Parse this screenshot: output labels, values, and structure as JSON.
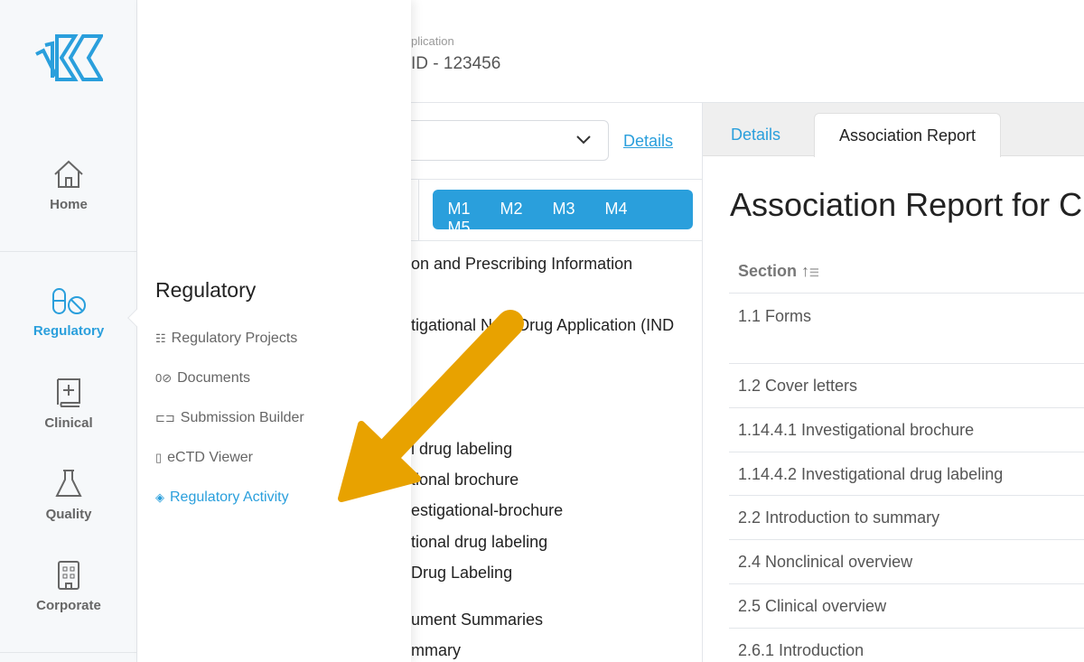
{
  "header": {
    "subtitle": "plication",
    "id": "ID - 123456"
  },
  "rail": {
    "items": [
      {
        "label": "Home",
        "icon": "home-icon"
      },
      {
        "label": "Regulatory",
        "icon": "pill-icon",
        "active": true
      },
      {
        "label": "Clinical",
        "icon": "medical-book-icon"
      },
      {
        "label": "Quality",
        "icon": "flask-icon"
      },
      {
        "label": "Corporate",
        "icon": "building-icon"
      }
    ]
  },
  "flyout": {
    "title": "Regulatory",
    "items": [
      {
        "label": "Regulatory Projects",
        "icon": "checklist-icon"
      },
      {
        "label": "Documents",
        "icon": "pill-icon"
      },
      {
        "label": "Submission Builder",
        "icon": "folder-tree-icon"
      },
      {
        "label": "eCTD Viewer",
        "icon": "clipboard-icon"
      },
      {
        "label": "Regulatory Activity",
        "icon": "clipboard-badge-icon",
        "active": true
      }
    ]
  },
  "middle": {
    "details_link": "Details",
    "modules": [
      "M1",
      "M2",
      "M3",
      "M4",
      "M5"
    ],
    "tree": [
      "on and Prescribing Information",
      "tigational New Drug Application (IND",
      "l drug labeling",
      "tional brochure",
      "estigational-brochure",
      "tional drug labeling",
      "Drug Labeling",
      "ument Summaries",
      "mmary"
    ]
  },
  "right": {
    "tabs": [
      "Details",
      "Association Report"
    ],
    "active_tab": "Association Report",
    "title": "Association Report for C",
    "column": "Section",
    "rows": [
      "1.1 Forms",
      "1.2 Cover letters",
      "1.14.4.1 Investigational brochure",
      "1.14.4.2 Investigational drug labeling",
      "2.2 Introduction to summary",
      "2.4 Nonclinical overview",
      "2.5 Clinical overview",
      "2.6.1 Introduction"
    ]
  },
  "colors": {
    "accent": "#2a9fdc",
    "arrow": "#e8a200"
  }
}
